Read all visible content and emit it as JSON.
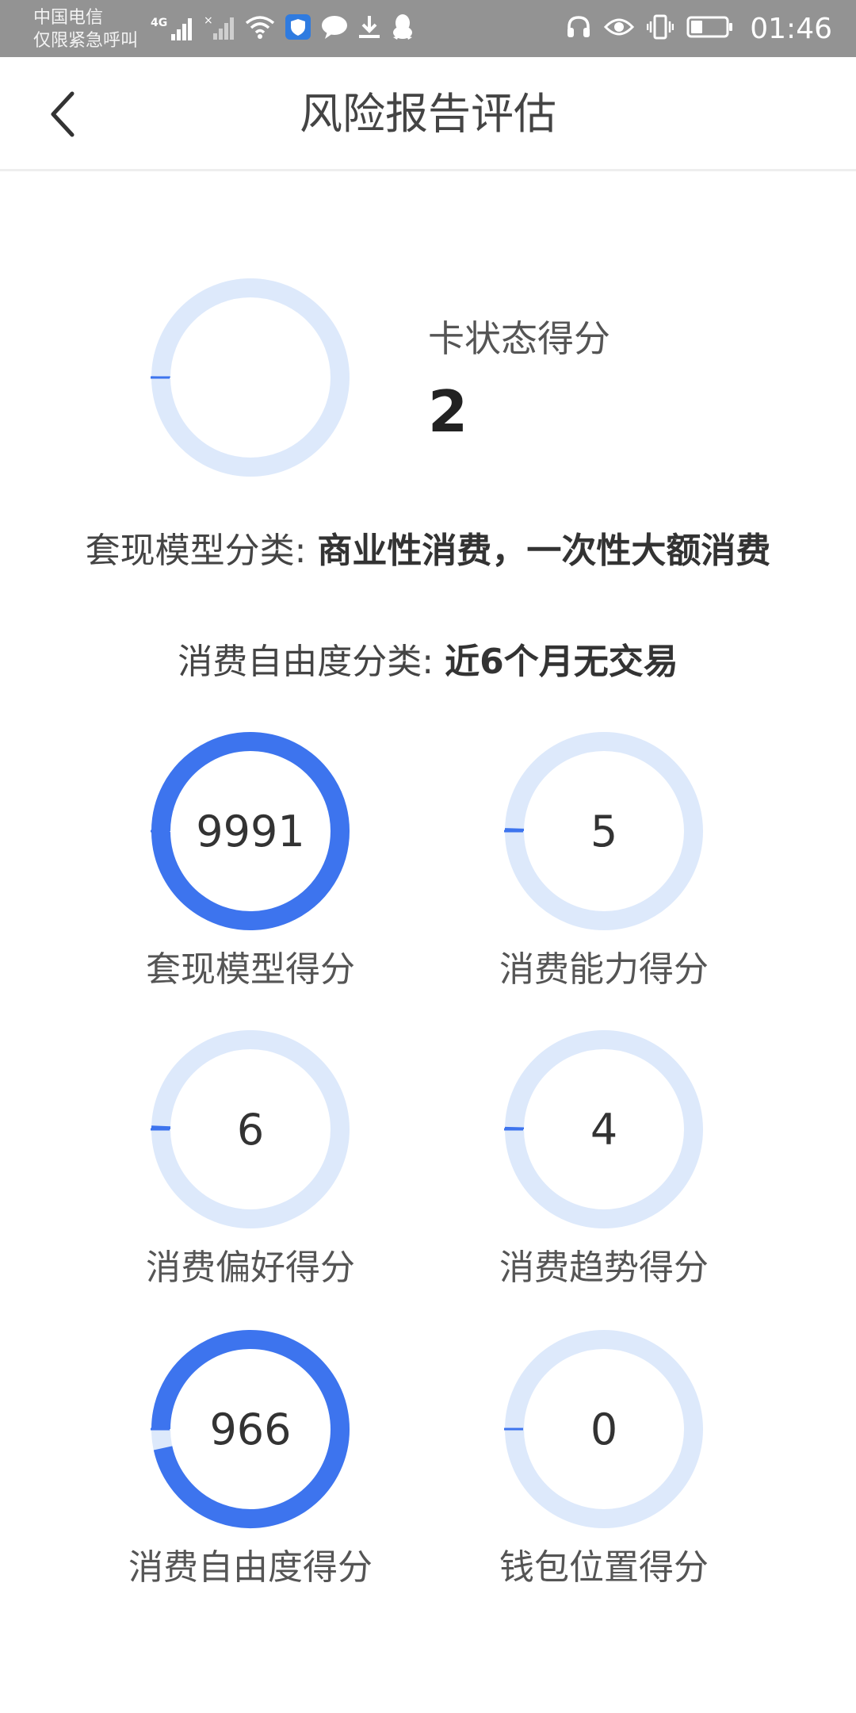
{
  "status_bar": {
    "carrier_line1": "中国电信",
    "carrier_line2": "仅限紧急呼叫",
    "network_label": "4G",
    "time": "01:46"
  },
  "header": {
    "title": "风险报告评估"
  },
  "card_status": {
    "label": "卡状态得分",
    "score": "2",
    "progress": 0.002
  },
  "summary": {
    "cashout_label": "套现模型分类: ",
    "cashout_value": "商业性消费，一次性大额消费",
    "freedom_label": "消费自由度分类: ",
    "freedom_value": "近6个月无交易"
  },
  "scores": [
    {
      "value": "9991",
      "label": "套现模型得分",
      "progress": 0.9991
    },
    {
      "value": "5",
      "label": "消费能力得分",
      "progress": 0.005
    },
    {
      "value": "6",
      "label": "消费偏好得分",
      "progress": 0.006
    },
    {
      "value": "4",
      "label": "消费趋势得分",
      "progress": 0.004
    },
    {
      "value": "966",
      "label": "消费自由度得分",
      "progress": 0.966
    },
    {
      "value": "0",
      "label": "钱包位置得分",
      "progress": 0.0
    }
  ],
  "colors": {
    "accent": "#3d74ee",
    "track": "#dde9fb",
    "status_bar": "#939393"
  }
}
